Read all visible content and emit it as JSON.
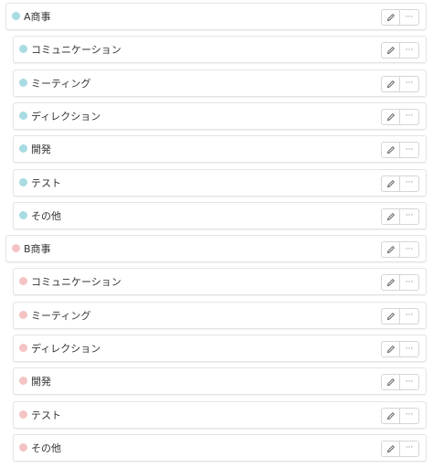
{
  "colors": {
    "group_a": "#a8dbe2",
    "group_b": "#f4c3c3"
  },
  "icons": {
    "edit": "pencil-icon",
    "more": "ellipsis-icon"
  },
  "groups": [
    {
      "name": "A商事",
      "color": "#a8dbe2",
      "items": [
        "コミュニケーション",
        "ミーティング",
        "ディレクション",
        "開発",
        "テスト",
        "その他"
      ]
    },
    {
      "name": "B商事",
      "color": "#f4c3c3",
      "items": [
        "コミュニケーション",
        "ミーティング",
        "ディレクション",
        "開発",
        "テスト",
        "その他"
      ]
    }
  ],
  "more_glyph": "···"
}
